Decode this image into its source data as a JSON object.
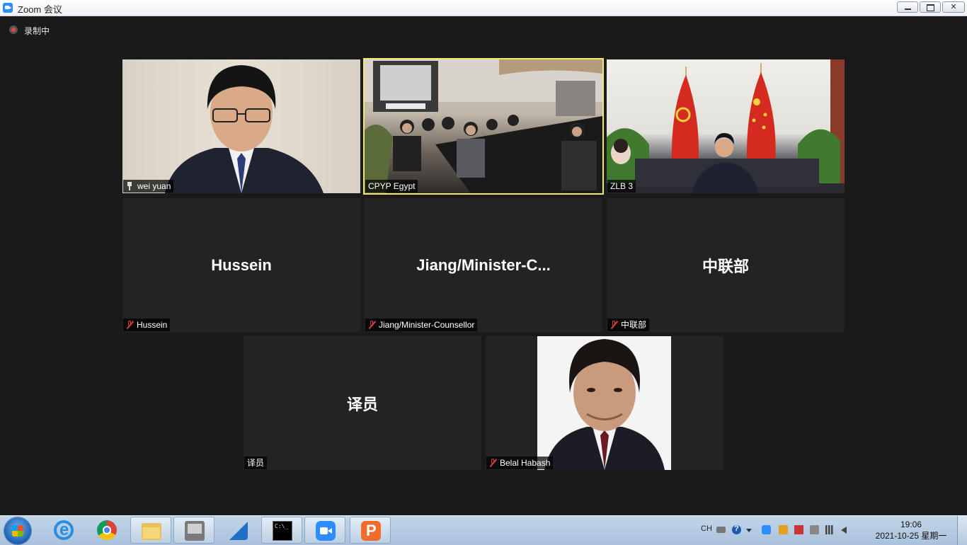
{
  "window": {
    "title": "Zoom 会议"
  },
  "recording": {
    "label": "录制中"
  },
  "participants": [
    {
      "name": "wei yuan",
      "video": true,
      "pinned": true
    },
    {
      "name": "CPYP Egypt",
      "video": true,
      "active_speaker": true
    },
    {
      "name": "ZLB 3",
      "video": true
    },
    {
      "name": "Hussein",
      "display": "Hussein",
      "muted": true
    },
    {
      "name": "Jiang/Minister-Counsellor",
      "display": "Jiang/Minister-C...",
      "muted": true
    },
    {
      "name": "中联部",
      "display": "中联部",
      "muted": true
    },
    {
      "name": "译员",
      "display": "译员"
    },
    {
      "name": "Belal Habash",
      "video": true,
      "muted": true
    }
  ],
  "taskbar": {
    "items": [
      "start-button",
      "ie-icon",
      "chrome-icon",
      "folder-icon",
      "tool-icon",
      "finance-icon",
      "cmd-icon",
      "zoom-icon",
      "p-icon"
    ],
    "tray": {
      "language": "CH"
    },
    "clock": {
      "time": "19:06",
      "date": "2021-10-25 星期一"
    }
  },
  "colors": {
    "background": "#1a1a1a",
    "tile": "#232323",
    "active_border": "#f0e873",
    "muted_icon": "#e03a3a"
  }
}
